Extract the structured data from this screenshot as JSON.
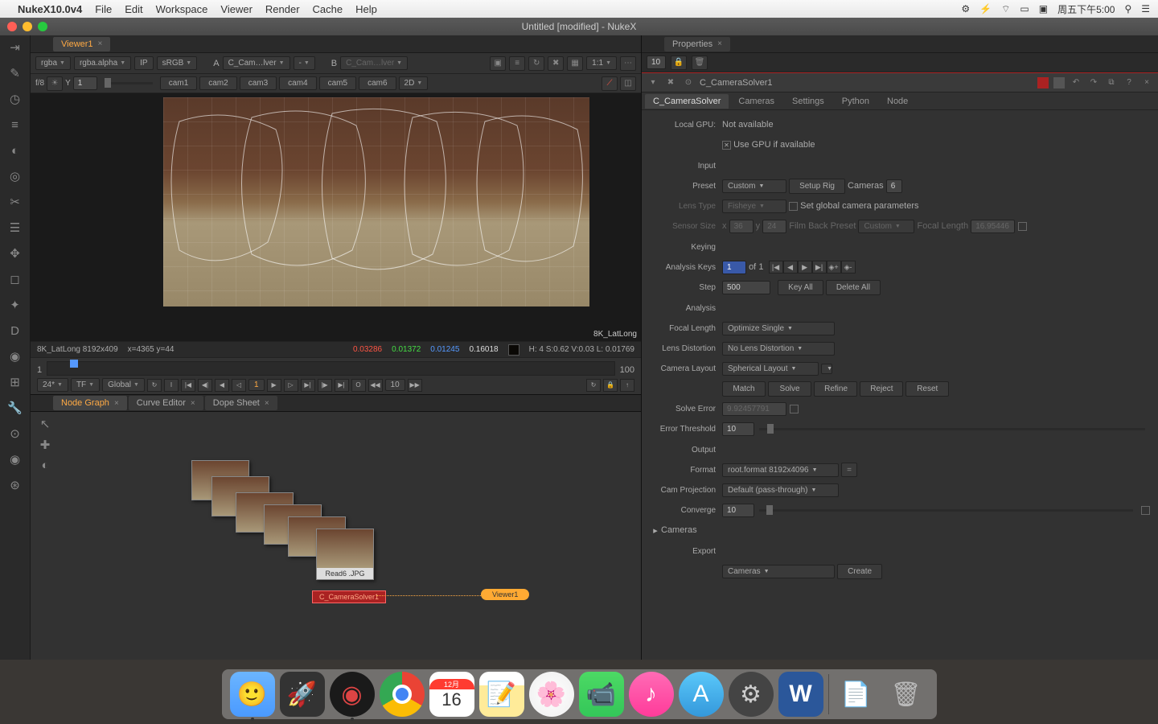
{
  "menubar": {
    "app": "NukeX10.0v4",
    "items": [
      "File",
      "Edit",
      "Workspace",
      "Viewer",
      "Render",
      "Cache",
      "Help"
    ],
    "clock": "周五下午5:00"
  },
  "window": {
    "title": "Untitled [modified] - NukeX"
  },
  "viewer": {
    "tab": "Viewer1",
    "rgba": "rgba",
    "alpha": "rgba.alpha",
    "ip": "IP",
    "srgb": "sRGB",
    "a_label": "A",
    "a_node": "C_Cam…lver",
    "a_sub": "-",
    "b_label": "B",
    "b_node": "C_Cam…lver",
    "ratio": "1:1",
    "wipe_label": "f/8",
    "wipe_y": "Y",
    "wipe_val": "1",
    "cams": [
      "cam1",
      "cam2",
      "cam3",
      "cam4",
      "cam5",
      "cam6"
    ],
    "view2d": "2D",
    "imglabel": "8K_LatLong",
    "info_name": "8K_LatLong 8192x409",
    "info_xy": "x=4365 y=44",
    "info_r": "0.03286",
    "info_g": "0.01372",
    "info_b": "0.01245",
    "info_a": "0.16018",
    "info_h": "H:  4 S:0.62 V:0.03  L: 0.01769"
  },
  "timeline": {
    "start": "1",
    "end": "100",
    "cur": "1",
    "fps": "24*",
    "tf": "TF",
    "global": "Global",
    "in": "1",
    "out": "100",
    "jump": "10"
  },
  "tabs_lower": {
    "ng": "Node Graph",
    "ce": "Curve Editor",
    "ds": "Dope Sheet"
  },
  "nodegraph": {
    "read_label": "Read6\n.JPG",
    "solver": "C_CameraSolver1",
    "viewer": "Viewer1"
  },
  "props": {
    "tab": "Properties",
    "count": "10",
    "node": "C_CameraSolver1",
    "tabs": [
      "C_CameraSolver",
      "Cameras",
      "Settings",
      "Python",
      "Node"
    ],
    "localgpu_l": "Local GPU:",
    "localgpu_v": "Not available",
    "usegpu": "Use GPU if available",
    "sect_input": "Input",
    "preset_l": "Preset",
    "preset_v": "Custom",
    "setuprig": "Setup Rig",
    "cameras_l": "Cameras",
    "cameras_v": "6",
    "lenstype_l": "Lens Type",
    "lenstype_v": "Fisheye",
    "setglobal": "Set global camera parameters",
    "sensor_l": "Sensor Size",
    "sensor_x": "x",
    "sensor_xv": "36",
    "sensor_y": "y",
    "sensor_yv": "24",
    "filmback_l": "Film Back Preset",
    "filmback_v": "Custom",
    "focal_l": "Focal Length",
    "focal_v": "16.95446",
    "sect_keying": "Keying",
    "anakeys_l": "Analysis Keys",
    "anakeys_v": "1",
    "anakeys_of": "of",
    "anakeys_t": "1",
    "step_l": "Step",
    "step_v": "500",
    "keyall": "Key All",
    "deleteall": "Delete All",
    "sect_analysis": "Analysis",
    "focallen_l": "Focal Length",
    "focallen_v": "Optimize Single",
    "lensdist_l": "Lens Distortion",
    "lensdist_v": "No Lens Distortion",
    "camlayout_l": "Camera Layout",
    "camlayout_v": "Spherical Layout",
    "match": "Match",
    "solve": "Solve",
    "refine": "Refine",
    "reject": "Reject",
    "reset": "Reset",
    "solveerr_l": "Solve Error",
    "solveerr_v": "9.92457791",
    "errthresh_l": "Error Threshold",
    "errthresh_v": "10",
    "sect_output": "Output",
    "format_l": "Format",
    "format_v": "root.format 8192x4096",
    "camproj_l": "Cam Projection",
    "camproj_v": "Default (pass-through)",
    "converge_l": "Converge",
    "converge_v": "10",
    "cameras_sect": "Cameras",
    "sect_export": "Export",
    "export_v": "Cameras",
    "create": "Create"
  }
}
